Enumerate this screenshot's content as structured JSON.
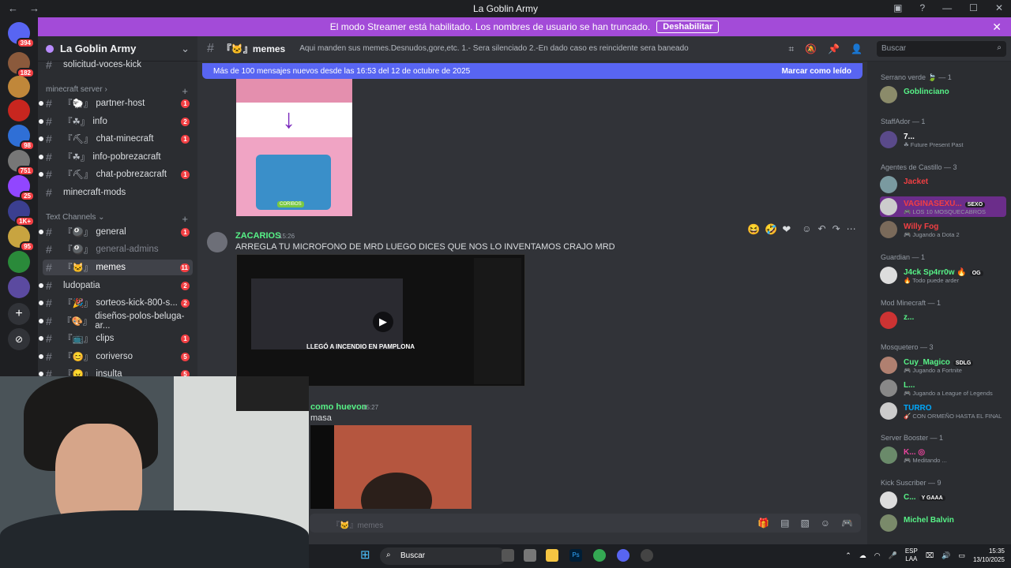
{
  "window": {
    "title": "La Goblin Army",
    "back": "←",
    "forward": "→"
  },
  "banner": {
    "text": "El modo Streamer está habilitado. Los nombres de usuario se han truncado.",
    "button": "Deshabilitar",
    "close": "✕"
  },
  "servers": [
    {
      "badge": "394"
    },
    {
      "badge": "182"
    },
    {
      "badge": ""
    },
    {
      "badge": ""
    },
    {
      "badge": "98"
    },
    {
      "badge": "751"
    },
    {
      "badge": "25"
    },
    {
      "badge": "1K+"
    },
    {
      "badge": "95"
    },
    {
      "badge": ""
    },
    {
      "badge": ""
    }
  ],
  "sidebar": {
    "guild": "La Goblin Army",
    "top_channel": "solicitud-voces-kick",
    "cat1": "minecraft server ›",
    "cat2": "Text Channels ⌄",
    "channels": [
      {
        "pre": "『🐑』",
        "name": "partner-host",
        "count": "1"
      },
      {
        "pre": "『☘』",
        "name": "info",
        "count": "2"
      },
      {
        "pre": "『⛏』",
        "name": "chat-minecraft",
        "count": "1"
      },
      {
        "pre": "『☘』",
        "name": "info-pobrezacraft",
        "count": ""
      },
      {
        "pre": "『⛏』",
        "name": "chat-pobrezacraft",
        "count": "1"
      },
      {
        "pre": "",
        "name": "minecraft-mods",
        "count": ""
      },
      {
        "pre": "『🎱』",
        "name": "general",
        "count": "1"
      },
      {
        "pre": "『🎱』",
        "name": "general-admins",
        "count": ""
      },
      {
        "pre": "『🐱』",
        "name": "memes",
        "count": "11"
      },
      {
        "pre": "",
        "name": "ludopatia",
        "count": "2"
      },
      {
        "pre": "『🎉』",
        "name": "sorteos-kick-800-s...",
        "count": "2"
      },
      {
        "pre": "『🎨』",
        "name": "diseños-polos-beluga-ar...",
        "count": ""
      },
      {
        "pre": "『📺』",
        "name": "clips",
        "count": "1"
      },
      {
        "pre": "『😊』",
        "name": "coriverso",
        "count": "5"
      },
      {
        "pre": "『😠』",
        "name": "insulta",
        "count": "5"
      }
    ]
  },
  "header": {
    "channel": "『🐱』memes",
    "topic": "Aqui manden sus memes.Desnudos,gore,etc. 1.- Sera silenciado 2.-En dado caso es reincidente sera baneado",
    "search_placeholder": "Buscar"
  },
  "new_messages": {
    "text": "Más de 100 mensajes nuevos desde las 16:53 del 12 de octubre de 2025",
    "mark": "Marcar como leído"
  },
  "messages": [
    {
      "author": "ZACARIOS",
      "time": "15:26",
      "text": "ARREGLA TU MICROFONO DE MRD LUEGO DICES QUE NOS LO INVENTAMOS CRAJO MRD",
      "video_title": "LLEGÓ A INCENDIO EN PAMPLONA"
    },
    {
      "author": "como huevon",
      "time": "15:27",
      "text": "masa"
    }
  ],
  "pig_label": "CORIBOS",
  "composer": {
    "placeholder": "『🐱』memes"
  },
  "members": {
    "groups": [
      {
        "label": "Serrano verde 🍃 — 1"
      },
      {
        "label": "StaffAdor — 1"
      },
      {
        "label": "Agentes de Castillo — 3"
      },
      {
        "label": "Guardian — 1"
      },
      {
        "label": "Mod Minecraft — 1"
      },
      {
        "label": "Mosquetero — 3"
      },
      {
        "label": "Server Booster — 1"
      },
      {
        "label": "Kick Suscriber — 9"
      }
    ],
    "list": [
      {
        "name": "Goblinciano",
        "status": "",
        "color": "#57f287",
        "tag": ""
      },
      {
        "name": "7...",
        "status": "☘ Future Present Past",
        "color": "#ffffff",
        "tag": ""
      },
      {
        "name": "Jacket",
        "status": "",
        "color": "#f23f43",
        "tag": ""
      },
      {
        "name": "VAGINASEXU...",
        "status": "🎮 LOS 10 MOSQUECABROS",
        "color": "#f23f43",
        "tag": "SEXO"
      },
      {
        "name": "Willy Fog",
        "status": "🎮 Jugando a Dota 2",
        "color": "#f23f43",
        "tag": ""
      },
      {
        "name": "J4ck Sp4rr0w 🔥",
        "status": "🔥 Todo puede arder",
        "color": "#57f287",
        "tag": "OG"
      },
      {
        "name": "z...",
        "status": "",
        "color": "#57f287",
        "tag": ""
      },
      {
        "name": "Cuy_Magico",
        "status": "🎮 Jugando a Fortnite",
        "color": "#57f287",
        "tag": "SDLG"
      },
      {
        "name": "L...",
        "status": "🎮 Jugando a League of Legends",
        "color": "#57f287",
        "tag": ""
      },
      {
        "name": "TURRO",
        "status": "🎸 CON ORMEÑO HASTA EL FINAL",
        "color": "#57f287",
        "tag": ""
      },
      {
        "name": "K... ◎",
        "status": "🎮 Meditando ...",
        "color": "#57f287",
        "tag": ""
      },
      {
        "name": "C...",
        "status": "",
        "color": "#57f287",
        "tag": "Y GAAA"
      },
      {
        "name": "Michel Balvin",
        "status": "",
        "color": "#57f287",
        "tag": ""
      }
    ]
  },
  "taskbar": {
    "search": "Buscar",
    "lang": "ESP",
    "lang2": "LAA",
    "time": "15:35",
    "date": "13/10/2025"
  }
}
